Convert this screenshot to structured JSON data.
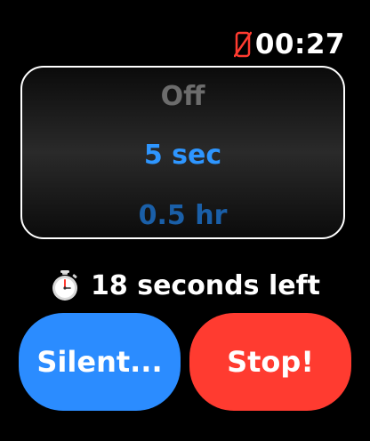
{
  "status": {
    "time": "00:27",
    "icon": "phone-disconnected-icon",
    "icon_color": "#ff3b30"
  },
  "picker": {
    "options": [
      "Off",
      "5 sec",
      "0.5 hr"
    ],
    "selected_index": 1,
    "colors": {
      "dim": "#6c6c6c",
      "selected": "#2e96ff",
      "next": "#1a5fa8"
    }
  },
  "countdown": {
    "icon": "stopwatch-icon",
    "text": "18 seconds left"
  },
  "buttons": {
    "silent_label": "Silent...",
    "silent_color": "#2b8cff",
    "stop_label": "Stop!",
    "stop_color": "#ff3b30"
  }
}
